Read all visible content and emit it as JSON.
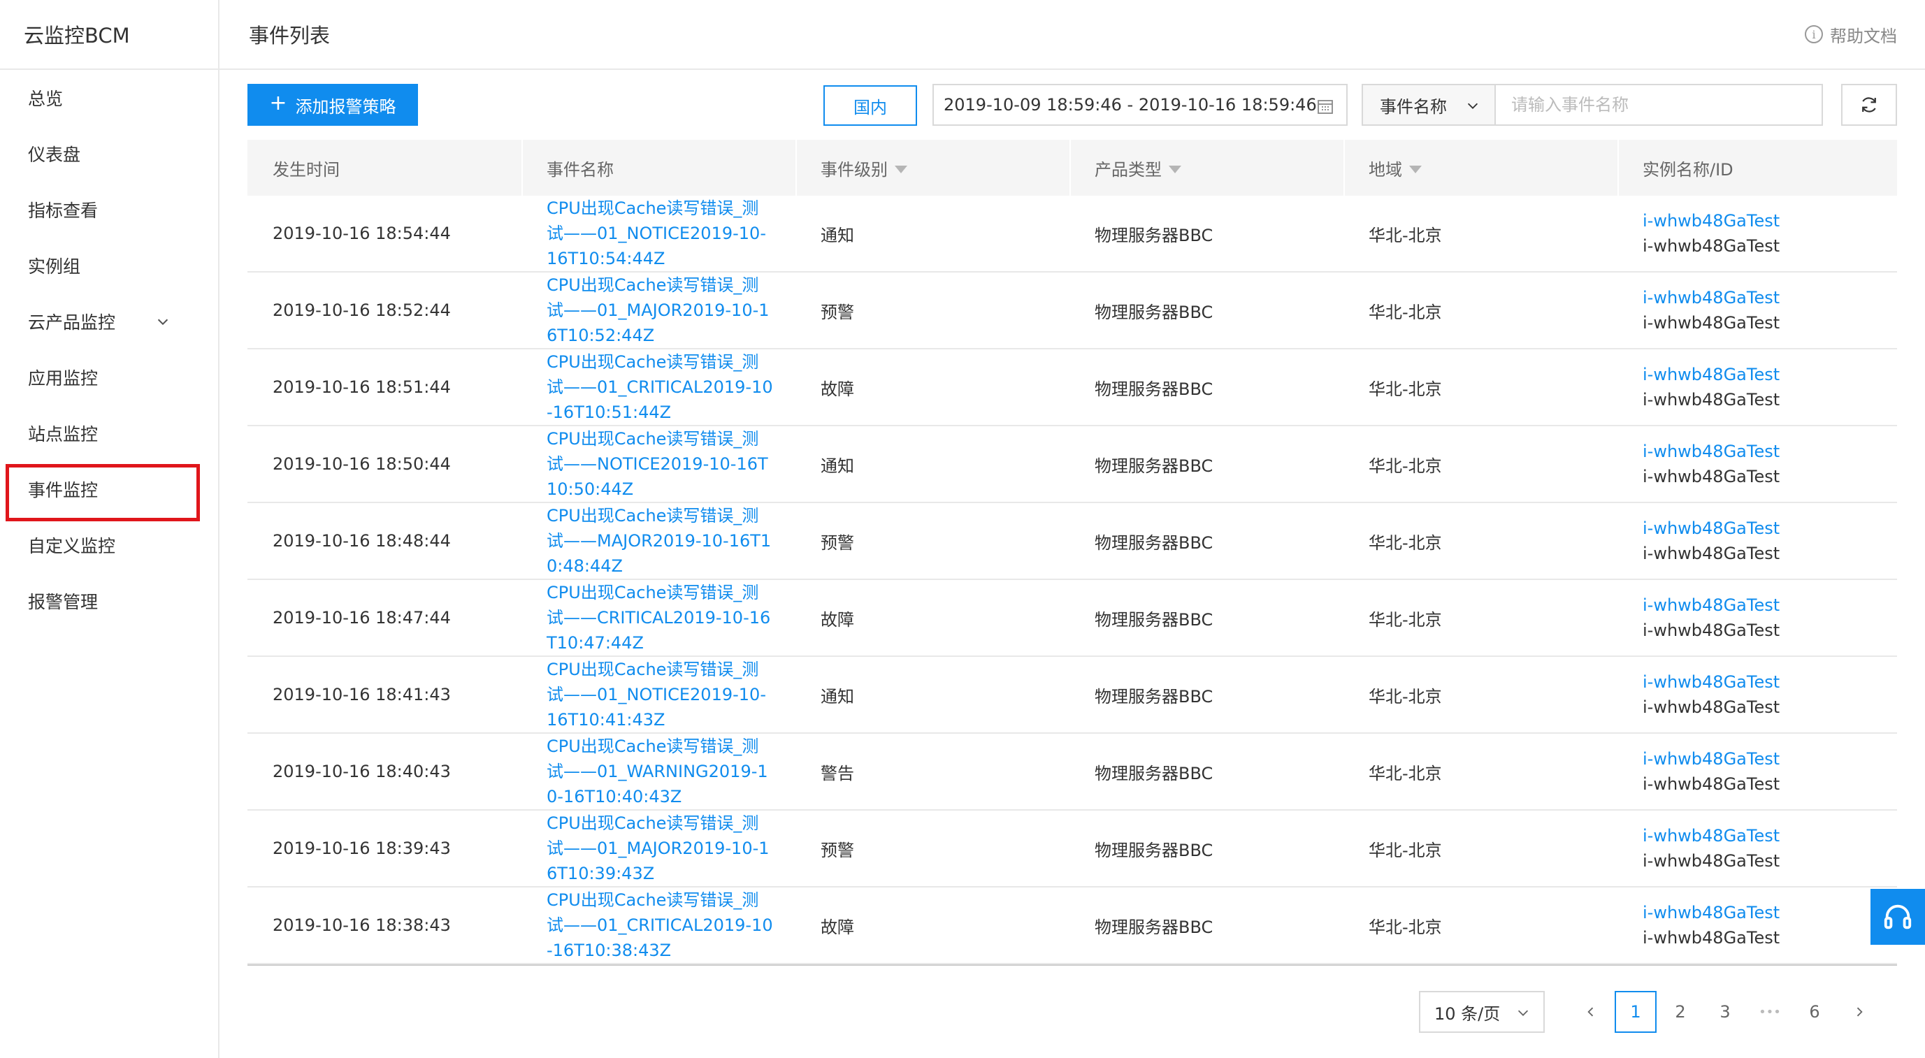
{
  "app": {
    "brand": "云监控BCM"
  },
  "sidebar": {
    "items": [
      {
        "label": "总览"
      },
      {
        "label": "仪表盘"
      },
      {
        "label": "指标查看"
      },
      {
        "label": "实例组"
      },
      {
        "label": "云产品监控"
      },
      {
        "label": "应用监控"
      },
      {
        "label": "站点监控"
      },
      {
        "label": "事件监控"
      },
      {
        "label": "自定义监控"
      },
      {
        "label": "报警管理"
      }
    ],
    "highlight_color": "#e0161b"
  },
  "header": {
    "title": "事件列表",
    "help_label": "帮助文档"
  },
  "toolbar": {
    "add_label": "添加报警策略",
    "region_label": "国内",
    "date_range": "2019-10-09 18:59:46 - 2019-10-16 18:59:46",
    "filter_field": "事件名称",
    "search_placeholder": "请输入事件名称"
  },
  "table": {
    "columns": [
      "发生时间",
      "事件名称",
      "事件级别",
      "产品类型",
      "地域",
      "实例名称/ID"
    ],
    "rows": [
      {
        "time": "2019-10-16 18:54:44",
        "name": "CPU出现Cache读写错误_测试——01_NOTICE2019-10-16T10:54:44Z",
        "level": "通知",
        "product": "物理服务器BBC",
        "region": "华北-北京",
        "instance_name": "i-whwb48GaTest",
        "instance_id": "i-whwb48GaTest"
      },
      {
        "time": "2019-10-16 18:52:44",
        "name": "CPU出现Cache读写错误_测试——01_MAJOR2019-10-16T10:52:44Z",
        "level": "预警",
        "product": "物理服务器BBC",
        "region": "华北-北京",
        "instance_name": "i-whwb48GaTest",
        "instance_id": "i-whwb48GaTest"
      },
      {
        "time": "2019-10-16 18:51:44",
        "name": "CPU出现Cache读写错误_测试——01_CRITICAL2019-10-16T10:51:44Z",
        "level": "故障",
        "product": "物理服务器BBC",
        "region": "华北-北京",
        "instance_name": "i-whwb48GaTest",
        "instance_id": "i-whwb48GaTest"
      },
      {
        "time": "2019-10-16 18:50:44",
        "name": "CPU出现Cache读写错误_测试——NOTICE2019-10-16T10:50:44Z",
        "level": "通知",
        "product": "物理服务器BBC",
        "region": "华北-北京",
        "instance_name": "i-whwb48GaTest",
        "instance_id": "i-whwb48GaTest"
      },
      {
        "time": "2019-10-16 18:48:44",
        "name": "CPU出现Cache读写错误_测试——MAJOR2019-10-16T10:48:44Z",
        "level": "预警",
        "product": "物理服务器BBC",
        "region": "华北-北京",
        "instance_name": "i-whwb48GaTest",
        "instance_id": "i-whwb48GaTest"
      },
      {
        "time": "2019-10-16 18:47:44",
        "name": "CPU出现Cache读写错误_测试——CRITICAL2019-10-16T10:47:44Z",
        "level": "故障",
        "product": "物理服务器BBC",
        "region": "华北-北京",
        "instance_name": "i-whwb48GaTest",
        "instance_id": "i-whwb48GaTest"
      },
      {
        "time": "2019-10-16 18:41:43",
        "name": "CPU出现Cache读写错误_测试——01_NOTICE2019-10-16T10:41:43Z",
        "level": "通知",
        "product": "物理服务器BBC",
        "region": "华北-北京",
        "instance_name": "i-whwb48GaTest",
        "instance_id": "i-whwb48GaTest"
      },
      {
        "time": "2019-10-16 18:40:43",
        "name": "CPU出现Cache读写错误_测试——01_WARNING2019-10-16T10:40:43Z",
        "level": "警告",
        "product": "物理服务器BBC",
        "region": "华北-北京",
        "instance_name": "i-whwb48GaTest",
        "instance_id": "i-whwb48GaTest"
      },
      {
        "time": "2019-10-16 18:39:43",
        "name": "CPU出现Cache读写错误_测试——01_MAJOR2019-10-16T10:39:43Z",
        "level": "预警",
        "product": "物理服务器BBC",
        "region": "华北-北京",
        "instance_name": "i-whwb48GaTest",
        "instance_id": "i-whwb48GaTest"
      },
      {
        "time": "2019-10-16 18:38:43",
        "name": "CPU出现Cache读写错误_测试——01_CRITICAL2019-10-16T10:38:43Z",
        "level": "故障",
        "product": "物理服务器BBC",
        "region": "华北-北京",
        "instance_name": "i-whwb48GaTest",
        "instance_id": "i-whwb48GaTest"
      }
    ]
  },
  "pagination": {
    "page_size_label": "10 条/页",
    "pages": [
      "1",
      "2",
      "3",
      "•••",
      "6"
    ],
    "current": "1"
  },
  "colors": {
    "accent": "#108cee",
    "header_bg": "#f5f5f5",
    "border": "#e8e8e8"
  },
  "icons": {
    "help": "info-circle-icon",
    "calendar": "calendar-icon",
    "refresh": "refresh-icon",
    "float": "headset-icon"
  }
}
